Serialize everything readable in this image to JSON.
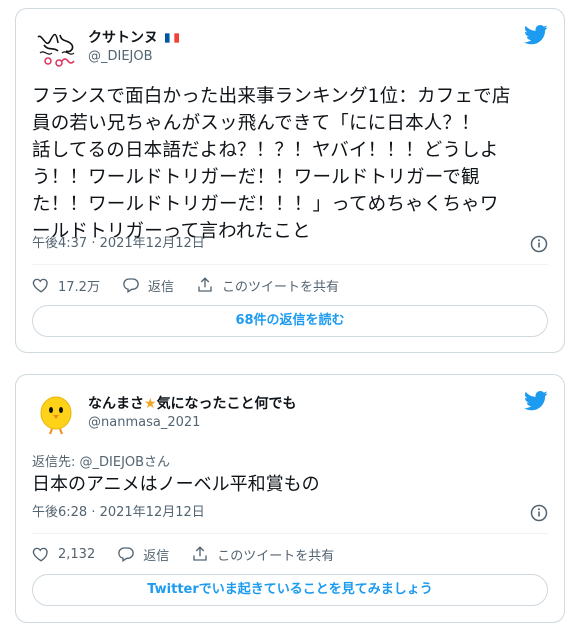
{
  "tweet1": {
    "display_name": "クサトンヌ",
    "flag": "🇫🇷",
    "handle": "@_DIEJOB",
    "text_lines": [
      "フランスで面白かった出来事ランキング1位：カフェで店",
      "員の若い兄ちゃんがスッ飛んできて「にに日本人？！",
      "話してるの日本語だよね？！？！ヤバイ！！！どうしよ",
      "う！！ワールドトリガーだ！！ワールドトリガーで観",
      "た！！ワールドトリガーだ！！！」ってめちゃくちゃワ",
      "ールドトリガーって言われたこと"
    ],
    "timestamp": "午後4:37 · 2021年12月12日",
    "like_count": "17.2万",
    "reply_label": "返信",
    "share_label": "このツイートを共有",
    "read_replies": "68件の返信を読む"
  },
  "tweet2": {
    "display_name_part1": "なんまさ",
    "display_name_part2": "気になったこと何でも",
    "star": "★",
    "handle": "@nanmasa_2021",
    "reply_to": "返信先: @_DIEJOBさん",
    "text": "日本のアニメはノーベル平和賞もの",
    "timestamp": "午後6:28 · 2021年12月12日",
    "like_count": "2,132",
    "reply_label": "返信",
    "share_label": "このツイートを共有",
    "cta": "Twitterでいま起きていることを見てみましょう"
  },
  "colors": {
    "twitter_blue": "#1d9bf0",
    "text": "#0f1419",
    "secondary": "#536471",
    "border": "#cfd9de",
    "star": "#f4a623"
  }
}
